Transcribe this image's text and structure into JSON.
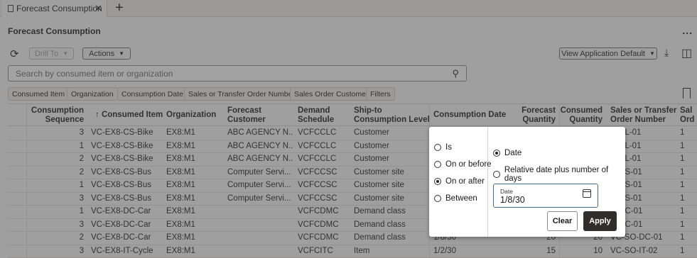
{
  "tab": {
    "label": "Forecast Consumption",
    "close": "✕",
    "add": "+"
  },
  "page_title": "Forecast Consumption",
  "more_menu": "...",
  "toolbar": {
    "drill_to": "Drill To",
    "actions": "Actions",
    "view": "View Application Default"
  },
  "search": {
    "placeholder": "Search by consumed item or organization"
  },
  "chips": [
    "Consumed Item",
    "Organization",
    "Consumption Date",
    "Sales or Transfer Order Number",
    "Sales Order Customer",
    "Filters"
  ],
  "table": {
    "headers": {
      "seq": [
        "Consumption",
        "Sequence"
      ],
      "item": "↑ Consumed Item",
      "org": "Organization",
      "cust": [
        "Forecast",
        "Customer"
      ],
      "sched": [
        "Demand",
        "Schedule"
      ],
      "ship": [
        "Ship-to",
        "Consumption Level"
      ],
      "date": "Consumption Date",
      "fq": [
        "Forecast",
        "Quantity"
      ],
      "cq": [
        "Consumed",
        "Quantity"
      ],
      "sto": [
        "Sales or Transfer",
        "Order Number"
      ],
      "sal": [
        "Sal",
        "Ord"
      ]
    },
    "rows": [
      {
        "seq": "3",
        "item": "VC-EX8-CS-Bike",
        "org": "EX8:M1",
        "cust": "ABC AGENCY N...",
        "sched": "VCFCCLC",
        "ship": "Customer",
        "date": "",
        "fq": "",
        "cq": "",
        "sto": "D-CL-01",
        "sal": "1"
      },
      {
        "seq": "1",
        "item": "VC-EX8-CS-Bike",
        "org": "EX8:M1",
        "cust": "ABC AGENCY N...",
        "sched": "VCFCCLC",
        "ship": "Customer",
        "date": "",
        "fq": "",
        "cq": "",
        "sto": "D-CL-01",
        "sal": "1"
      },
      {
        "seq": "2",
        "item": "VC-EX8-CS-Bike",
        "org": "EX8:M1",
        "cust": "ABC AGENCY N...",
        "sched": "VCFCCLC",
        "ship": "Customer",
        "date": "",
        "fq": "",
        "cq": "",
        "sto": "D-CL-01",
        "sal": "1"
      },
      {
        "seq": "2",
        "item": "VC-EX8-CS-Bus",
        "org": "EX8:M1",
        "cust": "Computer Servi...",
        "sched": "VCFCCSC",
        "ship": "Customer site",
        "date": "",
        "fq": "",
        "cq": "",
        "sto": "D-CS-01",
        "sal": "1"
      },
      {
        "seq": "1",
        "item": "VC-EX8-CS-Bus",
        "org": "EX8:M1",
        "cust": "Computer Servi...",
        "sched": "VCFCCSC",
        "ship": "Customer site",
        "date": "",
        "fq": "",
        "cq": "",
        "sto": "D-CS-01",
        "sal": "1"
      },
      {
        "seq": "3",
        "item": "VC-EX8-CS-Bus",
        "org": "EX8:M1",
        "cust": "Computer Servi...",
        "sched": "VCFCCSC",
        "ship": "Customer site",
        "date": "",
        "fq": "",
        "cq": "",
        "sto": "D-CS-01",
        "sal": "1"
      },
      {
        "seq": "1",
        "item": "VC-EX8-DC-Car",
        "org": "EX8:M1",
        "cust": "",
        "sched": "VCFCDMC",
        "ship": "Demand class",
        "date": "",
        "fq": "",
        "cq": "",
        "sto": "D-DC-01",
        "sal": "1"
      },
      {
        "seq": "3",
        "item": "VC-EX8-DC-Car",
        "org": "EX8:M1",
        "cust": "",
        "sched": "VCFCDMC",
        "ship": "Demand class",
        "date": "",
        "fq": "",
        "cq": "",
        "sto": "D-DC-01",
        "sal": "1"
      },
      {
        "seq": "2",
        "item": "VC-EX8-DC-Car",
        "org": "EX8:M1",
        "cust": "",
        "sched": "VCFCDMC",
        "ship": "Demand class",
        "date": "1/8/30",
        "fq": "20",
        "cq": "20",
        "sto": "VC-SO-DC-01",
        "sal": "1"
      },
      {
        "seq": "3",
        "item": "VC-EX8-IT-Cycle",
        "org": "EX8:M1",
        "cust": "",
        "sched": "VCFCITC",
        "ship": "Item",
        "date": "1/2/30",
        "fq": "15",
        "cq": "10",
        "sto": "VC-SO-IT-02",
        "sal": "1"
      }
    ]
  },
  "popup": {
    "operators": [
      {
        "label": "Is",
        "selected": false
      },
      {
        "label": "On or before",
        "selected": false
      },
      {
        "label": "On or after",
        "selected": true
      },
      {
        "label": "Between",
        "selected": false
      }
    ],
    "modes": [
      {
        "label": "Date",
        "selected": true
      },
      {
        "label": "Relative date plus number of days",
        "selected": false
      }
    ],
    "date_label": "Date",
    "date_value": "1/8/30",
    "clear": "Clear",
    "apply": "Apply"
  }
}
